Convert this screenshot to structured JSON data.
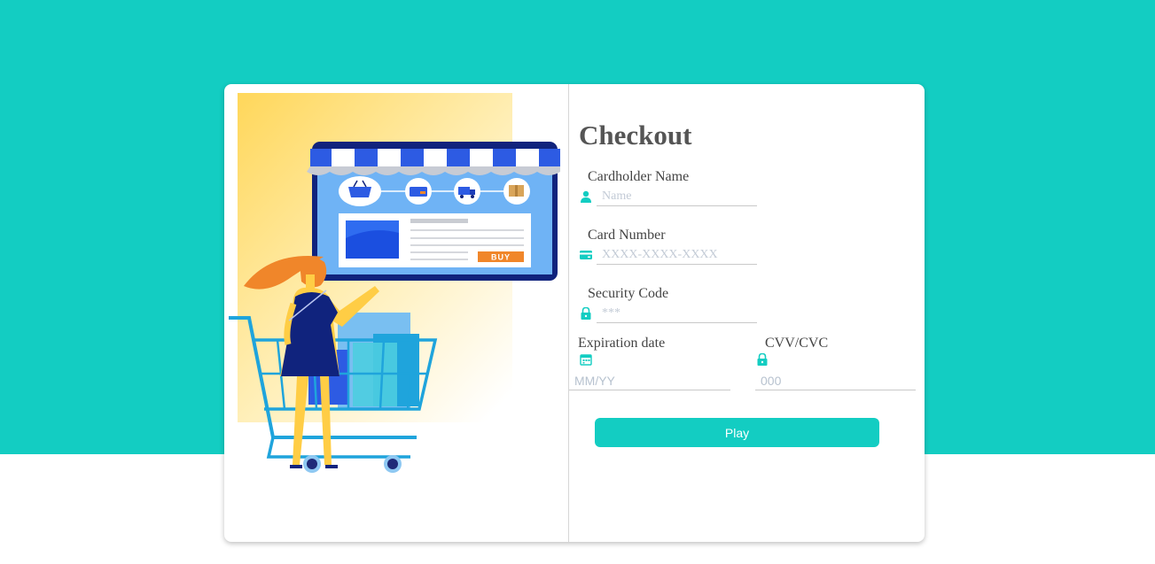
{
  "checkout": {
    "title": "Checkout",
    "cardholder": {
      "label": "Cardholder Name",
      "placeholder": "Name"
    },
    "card_number": {
      "label": "Card Number",
      "placeholder": "XXXX-XXXX-XXXX"
    },
    "security_code": {
      "label": "Security Code",
      "placeholder": "***"
    },
    "expiration": {
      "label": "Expiration date",
      "placeholder": "MM/YY"
    },
    "cvv": {
      "label": "CVV/CVC",
      "placeholder": "000"
    },
    "submit_label": "Play"
  },
  "illustration": {
    "buy_label": "BUY",
    "icons": [
      "basket-icon",
      "credit-card-icon",
      "delivery-truck-icon",
      "package-icon"
    ]
  },
  "colors": {
    "accent": "#13cdc2",
    "store_frame": "#10237d",
    "awning_blue": "#2d5be3",
    "buy_orange": "#f0862a"
  }
}
